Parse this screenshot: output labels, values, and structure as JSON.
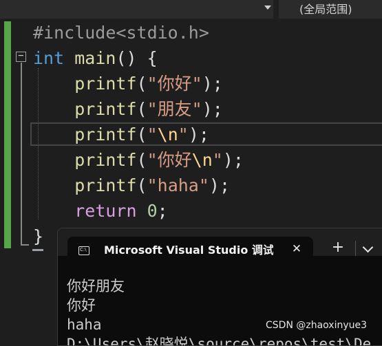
{
  "topbar": {
    "scope": "(全局范围)"
  },
  "code": {
    "line1": {
      "directive": "#include",
      "header": "<stdio.h>"
    },
    "line2": {
      "type": "int",
      "name": "main",
      "parens": "()",
      "brace": "{"
    },
    "line3": {
      "fn": "printf",
      "open": "(",
      "str": "\"你好\"",
      "close": ");"
    },
    "line4": {
      "fn": "printf",
      "open": "(",
      "str": "\"朋友\"",
      "close": ");"
    },
    "line5": {
      "fn": "printf",
      "open": "(",
      "str_q1": "\"",
      "esc": "\\n",
      "str_q2": "\"",
      "close": ");"
    },
    "line6": {
      "fn": "printf",
      "open": "(",
      "str_a": "\"你好",
      "esc": "\\n",
      "str_q2": "\"",
      "close": ");"
    },
    "line7": {
      "fn": "printf",
      "open": "(",
      "str": "\"haha\"",
      "close": ");"
    },
    "line8": {
      "kw": "return",
      "num": "0",
      "semi": ";"
    },
    "line9": {
      "brace": "}"
    }
  },
  "outline": {
    "collapse_glyph": "−"
  },
  "console": {
    "tab_icon_text": "C:\\",
    "tab_title": "Microsoft Visual Studio 调试控制台",
    "close_glyph": "✕",
    "new_tab_glyph": "+",
    "output": [
      "你好朋友",
      "你好",
      "haha",
      "D:\\Users\\赵晓悦\\source\\repos\\test\\De"
    ]
  },
  "watermark": "CSDN @zhaoxinyue3"
}
